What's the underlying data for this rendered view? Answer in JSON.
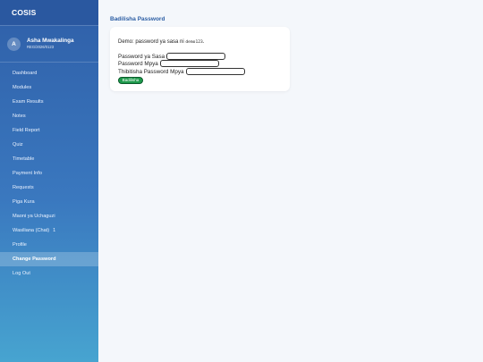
{
  "brand": "COSIS",
  "user": {
    "initial": "A",
    "name": "Asha Mwakalinga",
    "reg": "REG/2026/0123"
  },
  "nav": [
    {
      "label": "Dashboard"
    },
    {
      "label": "Modules"
    },
    {
      "label": "Exam Results"
    },
    {
      "label": "Notes"
    },
    {
      "label": "Field Report"
    },
    {
      "label": "Quiz"
    },
    {
      "label": "Timetable"
    },
    {
      "label": "Payment Info"
    },
    {
      "label": "Requests"
    },
    {
      "label": "Piga Kura"
    },
    {
      "label": "Maoni ya Uchaguzi"
    },
    {
      "label": "Wasiliana (Chat)",
      "badge": "1"
    },
    {
      "label": "Profile"
    },
    {
      "label": "Change Password",
      "active": true
    },
    {
      "label": "Log Out"
    }
  ],
  "main": {
    "title": "Badilisha Password",
    "hint_text": "Demo: password ya sasa ni",
    "hint_code": "demo123",
    "hint_end": ".",
    "fields": {
      "current_label": "Password ya Sasa",
      "new_label": "Password Mpya",
      "confirm_label": "Thibitisha Password Mpya"
    },
    "save_label": "Badilisha"
  }
}
